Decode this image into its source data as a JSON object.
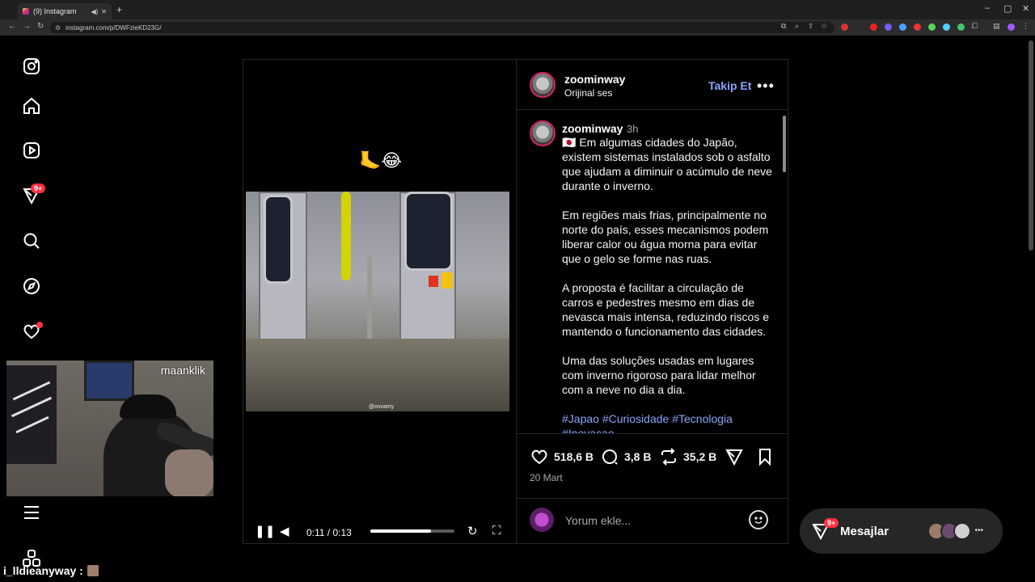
{
  "browser": {
    "tab_title": "(9) Instagram",
    "url": "instagram.com/p/DWFzieKD23G/",
    "new_tab": "+",
    "win_min": "–",
    "win_max": "▢",
    "win_close": "✕"
  },
  "nav": {
    "notifications_badge": "9+"
  },
  "webcam": {
    "streamer_name": "maanklik"
  },
  "chat_user": "i_lldieanyway :",
  "video": {
    "emoji": "🦶😂",
    "watermark": "@ovvamy",
    "time": "0:11 / 0:13",
    "progress_fraction": 0.72
  },
  "post": {
    "author": "zoominway",
    "audio": "Orijinal ses",
    "follow_label": "Takip Et",
    "more_label": "•••",
    "caption_age": "3h",
    "caption_text": "🇯🇵 Em algumas cidades do Japão, existem sistemas instalados sob o asfalto que ajudam a diminuir o acúmulo de neve durante o inverno.\n\nEm regiões mais frias, principalmente no norte do país, esses mecanismos podem liberar calor ou água morna para evitar que o gelo se forme nas ruas.\n\nA proposta é facilitar a circulação de carros e pedestres mesmo em dias de nevasca mais intensa, reduzindo riscos e mantendo o funcionamento das cidades.\n\nUma das soluções usadas em lugares com inverno rigoroso para lidar melhor com a neve no dia a dia.\n\n",
    "hashtags": "#Japao #Curiosidade #Tecnologia #Inovacao",
    "likes": "518,6 B",
    "comments": "3,8 B",
    "reposts": "35,2 B",
    "date": "20 Mart",
    "comment_placeholder": "Yorum ekle..."
  },
  "messages": {
    "label": "Mesajlar",
    "badge": "9+",
    "more": "•••"
  },
  "colors": {
    "link_blue": "#8aa6ff",
    "badge_red": "#ff3040",
    "border": "#262626"
  }
}
